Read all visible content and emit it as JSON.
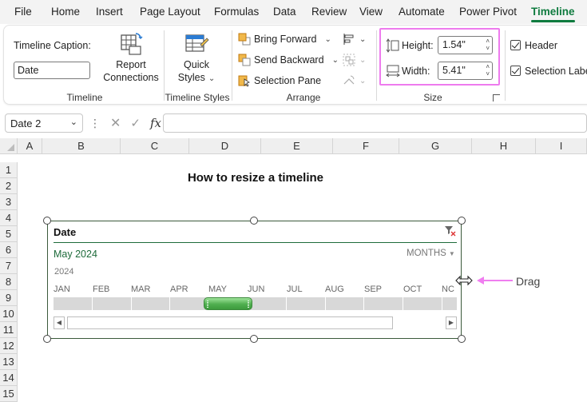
{
  "menu": {
    "tabs": [
      "File",
      "Home",
      "Insert",
      "Page Layout",
      "Formulas",
      "Data",
      "Review",
      "View",
      "Automate",
      "Power Pivot",
      "Timeline"
    ],
    "active_tab": "Timeline"
  },
  "ribbon": {
    "timeline_group": {
      "caption_label": "Timeline Caption:",
      "caption_value": "Date",
      "report_connections_line1": "Report",
      "report_connections_line2": "Connections",
      "group_label": "Timeline"
    },
    "styles_group": {
      "quick_styles_line1": "Quick",
      "quick_styles_line2": "Styles",
      "group_label": "Timeline Styles"
    },
    "arrange_group": {
      "bring_forward": "Bring Forward",
      "send_backward": "Send Backward",
      "selection_pane": "Selection Pane",
      "group_label": "Arrange"
    },
    "size_group": {
      "height_label": "Height:",
      "height_value": "1.54\"",
      "width_label": "Width:",
      "width_value": "5.41\"",
      "group_label": "Size"
    },
    "show_group": {
      "header_label": "Header",
      "selection_label": "Selection Label"
    }
  },
  "formula_bar": {
    "name_box": "Date 2",
    "formula": ""
  },
  "grid": {
    "columns": [
      "A",
      "B",
      "C",
      "D",
      "E",
      "F",
      "G",
      "H",
      "I"
    ],
    "rows": [
      "1",
      "2",
      "3",
      "4",
      "5",
      "6",
      "7",
      "8",
      "9",
      "10",
      "11",
      "12",
      "13",
      "14",
      "15"
    ]
  },
  "sheet": {
    "title": "How to resize a timeline"
  },
  "timeline": {
    "caption": "Date",
    "period_label": "May 2024",
    "level": "MONTHS",
    "year": "2024",
    "months": [
      "JAN",
      "FEB",
      "MAR",
      "APR",
      "MAY",
      "JUN",
      "JUL",
      "AUG",
      "SEP",
      "OCT",
      "NC"
    ],
    "selected_month": "MAY"
  },
  "annotation": {
    "drag_label": "Drag",
    "arrow_color": "#f07ef0"
  },
  "colors": {
    "accent": "#0f7b3f",
    "highlight_box": "#ee7bee",
    "selection_green": "#4fae4f"
  }
}
